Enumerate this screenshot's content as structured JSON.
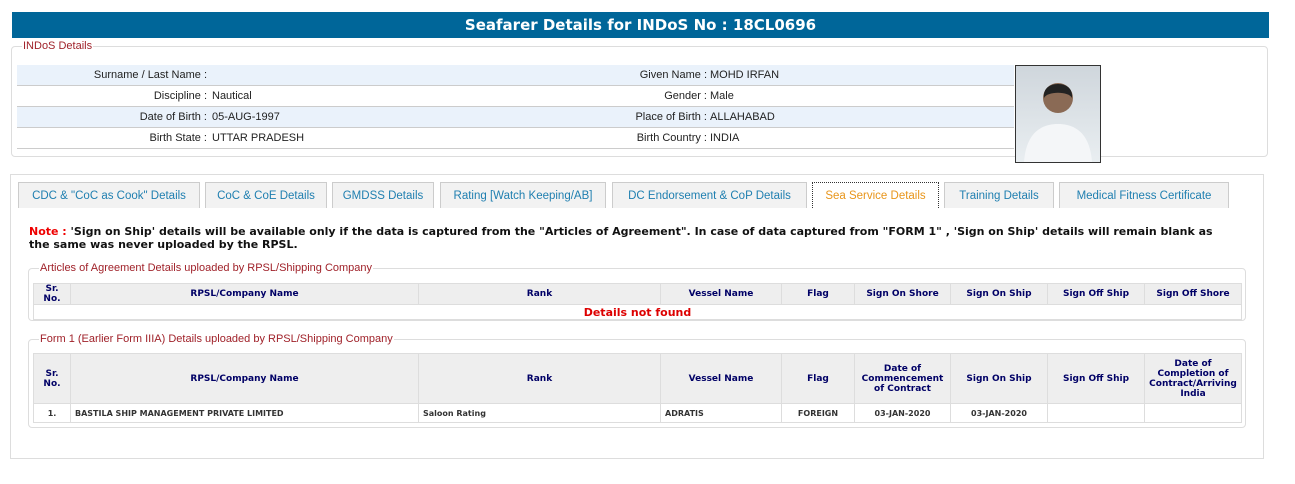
{
  "title": "Seafarer Details for INDoS No : 18CL0696",
  "indos": {
    "legend": "INDoS Details",
    "rows": [
      {
        "l1": "Surname / Last Name :",
        "v1": "",
        "l2": "Given Name :",
        "v2": "MOHD IRFAN"
      },
      {
        "l1": "Discipline :",
        "v1": "Nautical",
        "l2": "Gender :",
        "v2": "Male"
      },
      {
        "l1": "Date of Birth :",
        "v1": "05-AUG-1997",
        "l2": "Place of Birth :",
        "v2": "ALLAHABAD"
      },
      {
        "l1": "Birth State :",
        "v1": "UTTAR PRADESH",
        "l2": "Birth Country :",
        "v2": "INDIA"
      }
    ]
  },
  "tabs": [
    "CDC & \"CoC as Cook\" Details",
    "CoC & CoE Details",
    "GMDSS Details",
    "Rating [Watch Keeping/AB]",
    "DC Endorsement & CoP Details",
    "Sea Service Details",
    "Training Details",
    "Medical Fitness Certificate"
  ],
  "note": {
    "prefix": "Note :",
    "text": " 'Sign on Ship' details will be available only if the data is captured from the \"Articles of Agreement\". In case of data captured from \"FORM 1\" , 'Sign on Ship' details will remain blank as the same was never uploaded by the RPSL."
  },
  "aoa": {
    "legend": "Articles of Agreement Details uploaded by RPSL/Shipping Company",
    "headers": [
      "Sr. No.",
      "RPSL/Company Name",
      "Rank",
      "Vessel Name",
      "Flag",
      "Sign On Shore",
      "Sign On Ship",
      "Sign Off Ship",
      "Sign Off Shore"
    ],
    "empty": "Details not found"
  },
  "form1": {
    "legend": "Form 1 (Earlier Form IIIA) Details uploaded by RPSL/Shipping Company",
    "headers": [
      "Sr. No.",
      "RPSL/Company Name",
      "Rank",
      "Vessel Name",
      "Flag",
      "Date of Commencement of Contract",
      "Sign On Ship",
      "Sign Off Ship",
      "Date of Completion of Contract/Arriving India"
    ],
    "rows": [
      [
        "1.",
        "BASTILA SHIP MANAGEMENT PRIVATE LIMITED",
        "Saloon Rating",
        "ADRATIS",
        "FOREIGN",
        "03-JAN-2020",
        "03-JAN-2020",
        "",
        ""
      ]
    ]
  }
}
